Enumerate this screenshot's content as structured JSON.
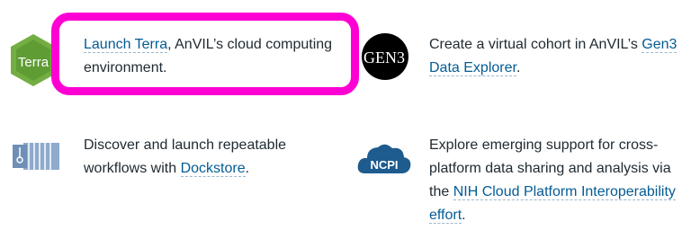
{
  "items": [
    {
      "logo_text": "Terra",
      "link": "Launch Terra",
      "after": ", AnVIL’s cloud computing environment."
    },
    {
      "logo_text": "GEN3",
      "before": "Create a virtual cohort in AnVIL’s ",
      "link": "Gen3 Data Explorer",
      "after": "."
    },
    {
      "logo_text": "",
      "before": "Discover and launch repeatable workflows with ",
      "link": "Dockstore",
      "after": "."
    },
    {
      "logo_text": "NCPI",
      "before": "Explore emerging support for cross-platform data sharing and analysis via the ",
      "link": "NIH Cloud Platform Interoperability effort",
      "after": "."
    }
  ],
  "colors": {
    "highlight": "#ff00d4",
    "link": "#035c94",
    "terra": "#74ae43",
    "gen3": "#000000",
    "ncpi": "#1e5b8e",
    "dockstore": "#6f8fb6"
  }
}
